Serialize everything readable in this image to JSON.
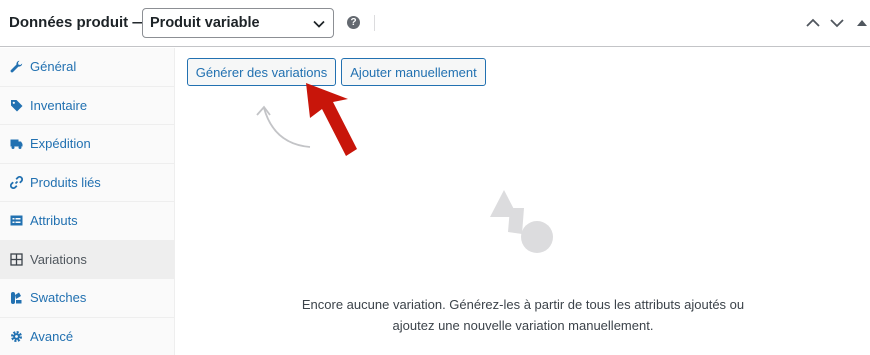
{
  "header": {
    "title": "Données produit —",
    "product_type": "Produit variable"
  },
  "sidebar": {
    "items": [
      {
        "label": "Général",
        "icon": "wrench-icon"
      },
      {
        "label": "Inventaire",
        "icon": "tag-icon"
      },
      {
        "label": "Expédition",
        "icon": "truck-icon"
      },
      {
        "label": "Produits liés",
        "icon": "link-icon"
      },
      {
        "label": "Attributs",
        "icon": "list-card-icon"
      },
      {
        "label": "Variations",
        "icon": "grid-icon",
        "active": true
      },
      {
        "label": "Swatches",
        "icon": "swatches-icon"
      },
      {
        "label": "Avancé",
        "icon": "gear-icon"
      }
    ]
  },
  "main": {
    "generate_label": "Générer des variations",
    "manual_label": "Ajouter manuellement",
    "empty_line1": "Encore aucune variation. Générez-les à partir de tous les attributs ajoutés ou",
    "empty_line2": "ajoutez une nouvelle variation manuellement."
  },
  "colors": {
    "link": "#2271b1",
    "annotation_arrow": "#c8150a",
    "placeholder_shapes": "#dcdcde"
  }
}
